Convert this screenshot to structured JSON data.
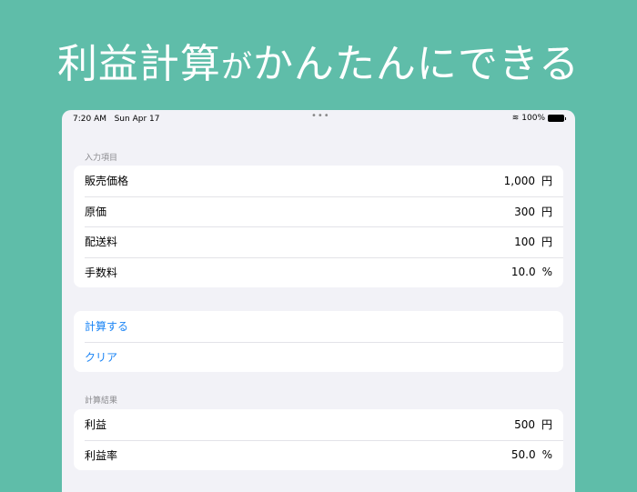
{
  "headline": {
    "main": "利益計算",
    "connector": "が",
    "rest": "かんたんにできる"
  },
  "status": {
    "time": "7:20 AM",
    "date": "Sun Apr 17",
    "battery": "100%"
  },
  "input_section": {
    "label": "入力項目",
    "rows": [
      {
        "label": "販売価格",
        "value": "1,000",
        "unit": "円"
      },
      {
        "label": "原価",
        "value": "300",
        "unit": "円"
      },
      {
        "label": "配送料",
        "value": "100",
        "unit": "円"
      },
      {
        "label": "手数料",
        "value": "10.0",
        "unit": "%"
      }
    ]
  },
  "actions": {
    "calculate": "計算する",
    "clear": "クリア"
  },
  "result_section": {
    "label": "計算結果",
    "rows": [
      {
        "label": "利益",
        "value": "500",
        "unit": "円"
      },
      {
        "label": "利益率",
        "value": "50.0",
        "unit": "%"
      }
    ]
  }
}
